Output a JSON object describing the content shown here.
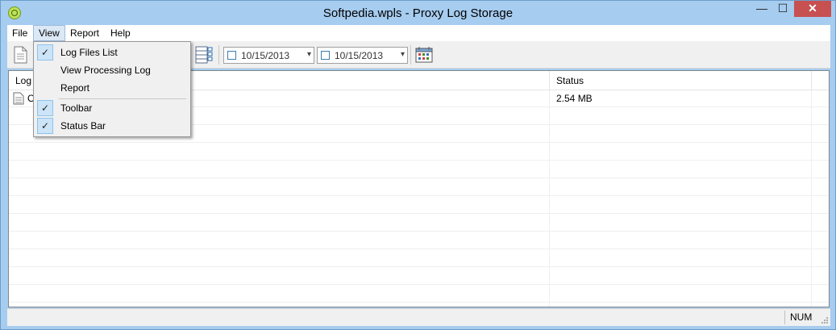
{
  "window": {
    "title": "Softpedia.wpls - Proxy Log Storage",
    "controls": {
      "minimize": "—",
      "maximize": "☐",
      "close": "✕"
    }
  },
  "menu": {
    "items": [
      "File",
      "View",
      "Report",
      "Help"
    ],
    "active": "View"
  },
  "view_menu": {
    "items": [
      {
        "label": "Log Files List",
        "checked": true
      },
      {
        "label": "View Processing Log",
        "checked": false
      },
      {
        "label": "Report",
        "checked": false
      },
      {
        "label": "Toolbar",
        "checked": true
      },
      {
        "label": "Status Bar",
        "checked": true
      }
    ]
  },
  "toolbar": {
    "date_from": "10/15/2013",
    "date_to": "10/15/2013"
  },
  "list": {
    "columns": [
      "Log",
      "Status"
    ],
    "rows": [
      {
        "log": "O",
        "status": "2.54 MB"
      }
    ]
  },
  "statusbar": {
    "num": "NUM"
  },
  "colors": {
    "frame": "#a6ccef",
    "close_button": "#c75050",
    "menu_highlight": "#cce4f7"
  }
}
